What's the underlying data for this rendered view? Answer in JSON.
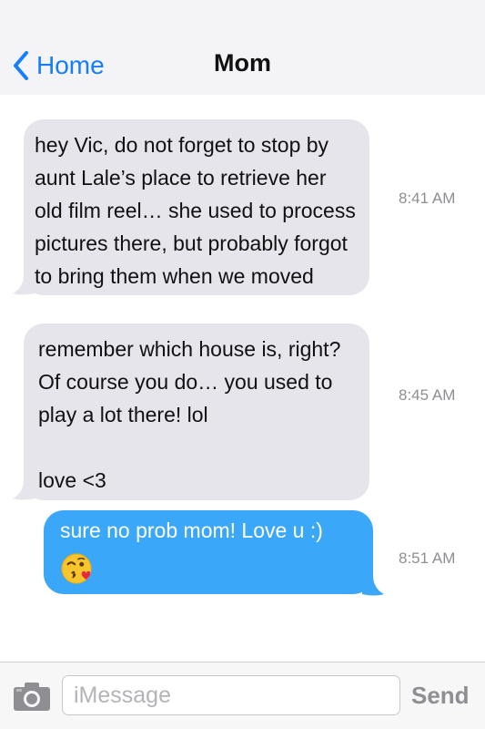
{
  "header": {
    "back_label": "Home",
    "title": "Mom",
    "accent_color": "#147efb"
  },
  "messages": [
    {
      "direction": "incoming",
      "text": "hey Vic, do not forget to stop by\naunt Lale’s place to retrieve her\nold film reel… she used to process\npictures there, but probably forgot\nto bring them when we moved",
      "time": "8:41 AM"
    },
    {
      "direction": "incoming",
      "text": "remember which house is, right?\nOf course you do… you used to\nplay a lot there! lol\n\nlove <3",
      "time": "8:45 AM"
    },
    {
      "direction": "outgoing",
      "text": "sure no prob mom! Love u :)",
      "emoji": "kissing-face-with-heart-emoji",
      "time": "8:51 AM"
    }
  ],
  "input_bar": {
    "camera_icon": "camera-icon",
    "placeholder": "iMessage",
    "value": "",
    "send_label": "Send"
  },
  "colors": {
    "incoming_bubble": "#e6e5eb",
    "outgoing_bubble": "#3aa7f8",
    "timestamp": "#8e8e93",
    "send_disabled": "#8e8e93"
  }
}
